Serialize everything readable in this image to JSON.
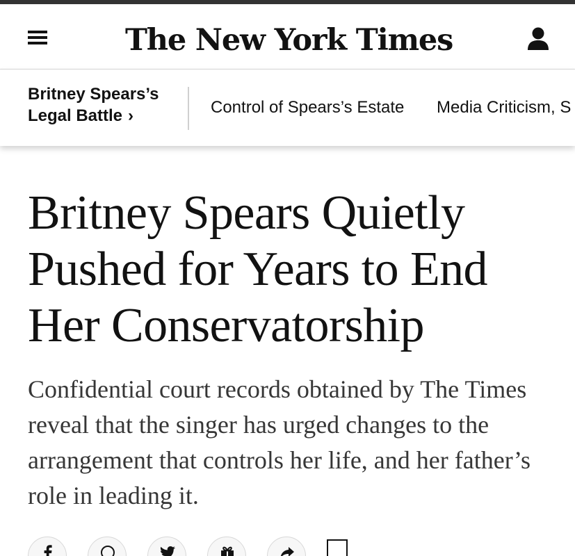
{
  "header": {
    "menu_icon": "hamburger-menu-icon",
    "logo_text": "The New York Times",
    "account_icon": "user-account-icon"
  },
  "subnav": {
    "title": "Britney Spears’s Legal Battle",
    "chevron": "›",
    "links": [
      "Control of Spears’s Estate",
      "Media Criticism, S"
    ]
  },
  "article": {
    "headline": "Britney Spears Quietly Pushed for Years to End Her Conservatorship",
    "summary": "Confidential court records obtained by The Times reveal that the singer has urged changes to the arrangement that controls her life, and her father’s role in leading it."
  },
  "share": {
    "buttons": [
      "facebook-icon",
      "whatsapp-icon",
      "twitter-icon",
      "gift-icon",
      "share-arrow-icon"
    ],
    "save_icon": "bookmark-icon"
  },
  "colors": {
    "top_strip": "#333333",
    "text": "#121212",
    "summary_text": "#363636",
    "divider": "#d0d0d0"
  }
}
